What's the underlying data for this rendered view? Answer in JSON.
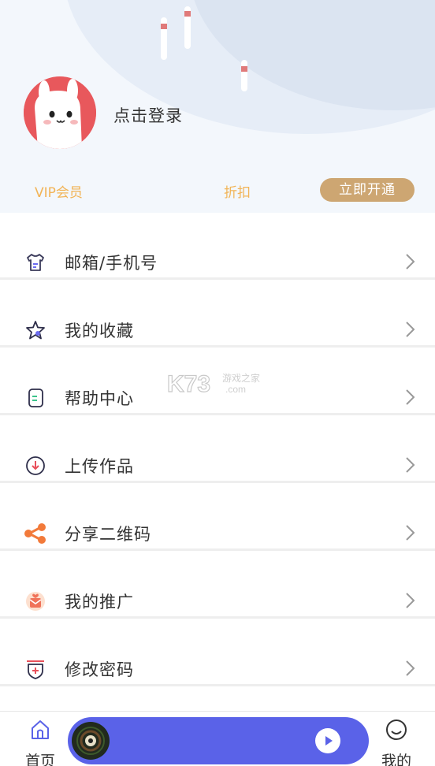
{
  "profile": {
    "login_text": "点击登录"
  },
  "vip": {
    "member_label": "VIP会员",
    "discount_label": "折扣",
    "open_button_label": "立即开通"
  },
  "menu": {
    "items": [
      {
        "label": "邮箱/手机号",
        "icon": "shirt-icon"
      },
      {
        "label": "我的收藏",
        "icon": "star-icon"
      },
      {
        "label": "帮助中心",
        "icon": "help-doc-icon"
      },
      {
        "label": "上传作品",
        "icon": "upload-icon"
      },
      {
        "label": "分享二维码",
        "icon": "share-icon"
      },
      {
        "label": "我的推广",
        "icon": "promotion-icon"
      },
      {
        "label": "修改密码",
        "icon": "shield-plus-icon"
      }
    ]
  },
  "watermark": {
    "brand": "K73",
    "site_name": "游戏之家",
    "domain": ".com"
  },
  "tabbar": {
    "home_label": "首页",
    "mine_label": "我的"
  },
  "colors": {
    "vip_text": "#f2b457",
    "open_button": "#cda672",
    "player_bg": "#5a62e8",
    "avatar_bg": "#e8585c"
  }
}
